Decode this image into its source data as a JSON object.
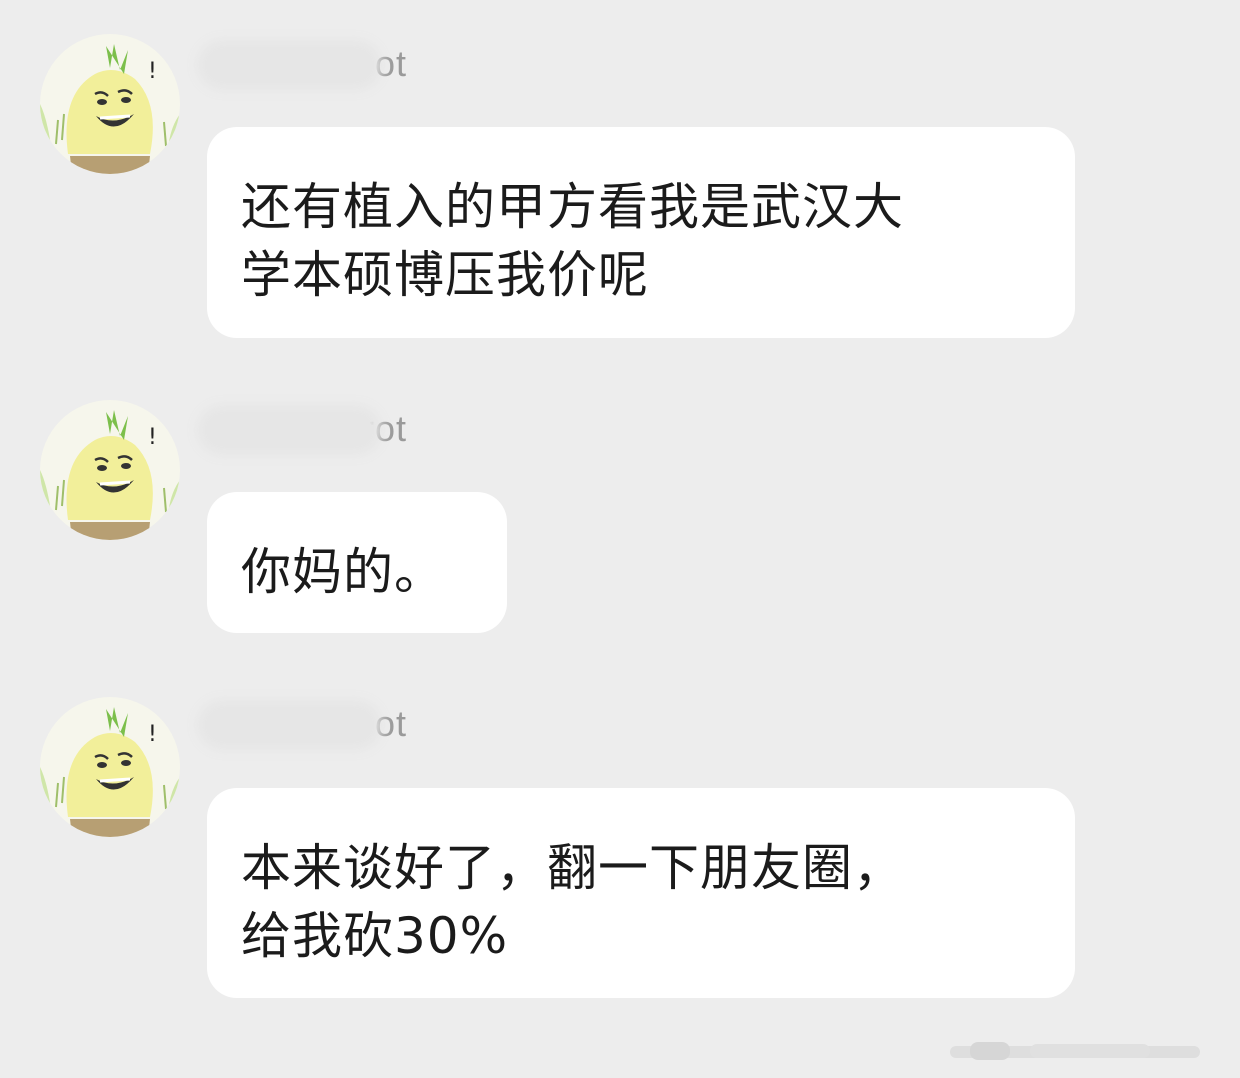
{
  "messages": [
    {
      "sender": "D··········rot",
      "sender_visible": "ot",
      "lines": [
        "还有植入的甲方看我是武汉大",
        "学本硕博压我价呢"
      ]
    },
    {
      "sender": "D··········rot",
      "sender_visible": "rot",
      "lines": [
        "你妈的。"
      ]
    },
    {
      "sender": "··········rot",
      "sender_visible": "ot",
      "lines": [
        "本来谈好了，翻一下朋友圈，",
        "给我砍30%"
      ]
    }
  ],
  "avatar_icon": "radish-meme-avatar-icon",
  "colors": {
    "background": "#ededed",
    "bubble": "#ffffff",
    "text": "#1b1b1b",
    "sender": "#9a9a9a"
  }
}
